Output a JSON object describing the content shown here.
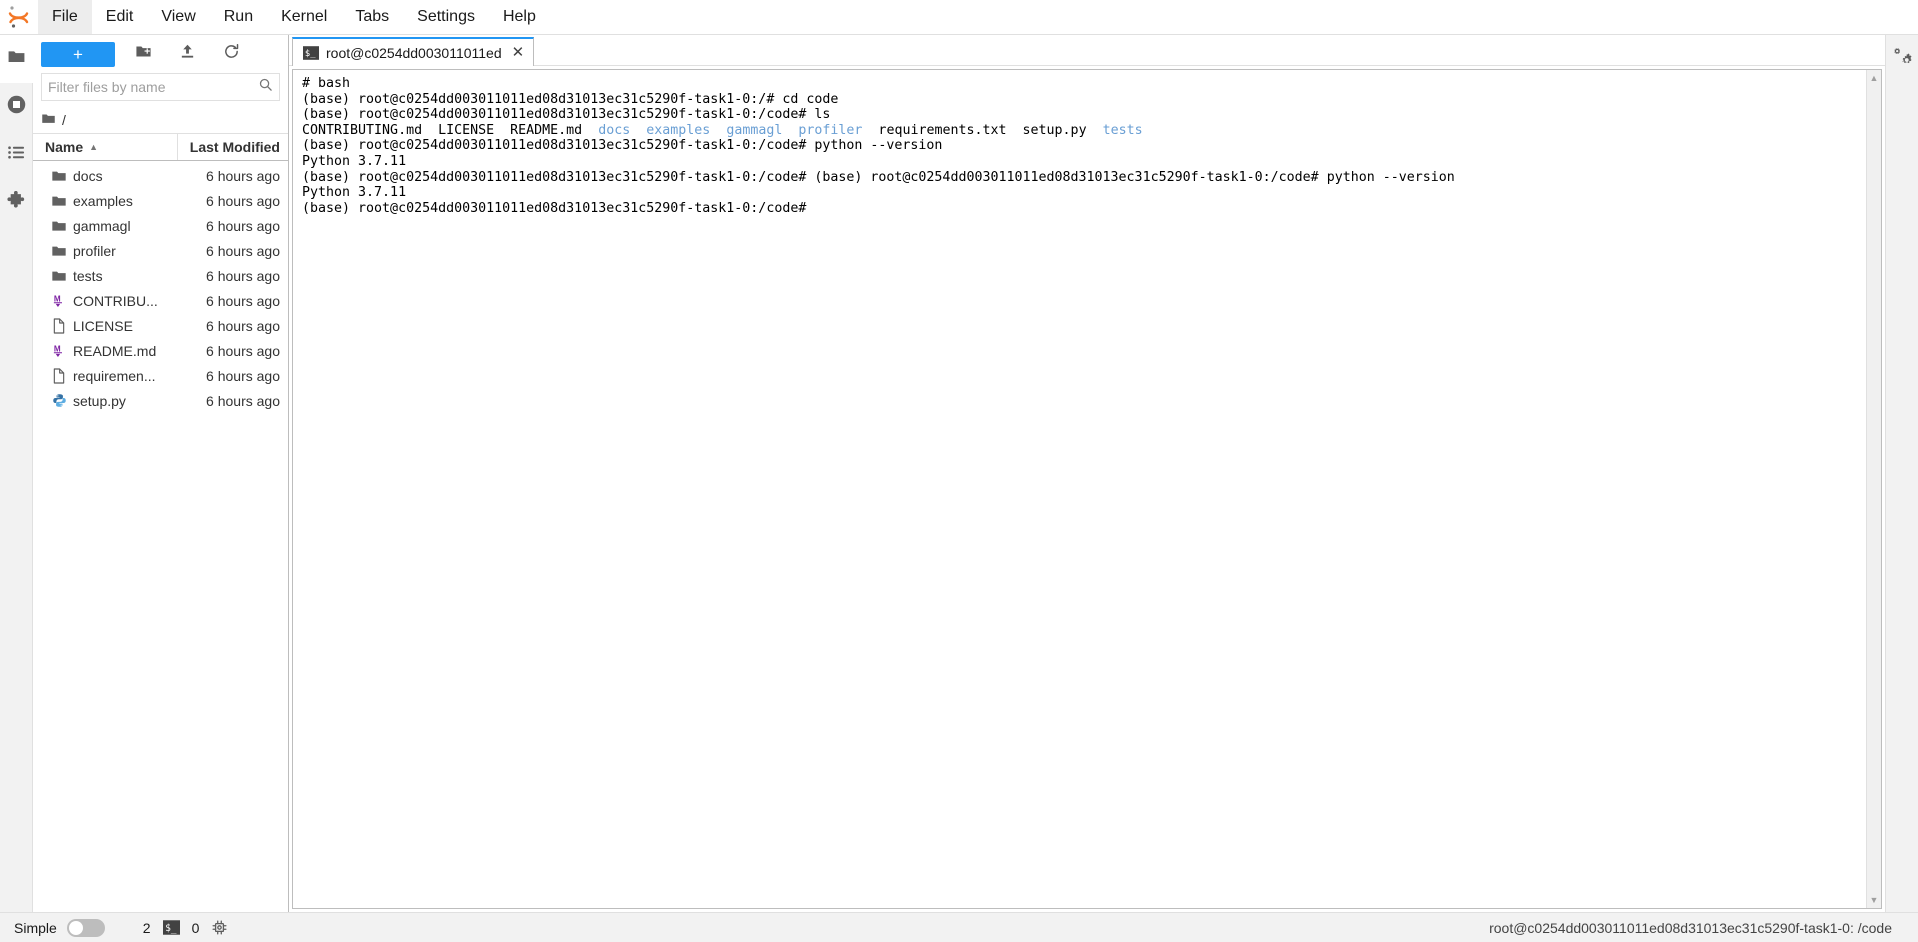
{
  "app": {
    "logo_icon": "jupyter-logo-icon"
  },
  "menubar": {
    "items": [
      {
        "label": "File",
        "name": "menu-file"
      },
      {
        "label": "Edit",
        "name": "menu-edit"
      },
      {
        "label": "View",
        "name": "menu-view"
      },
      {
        "label": "Run",
        "name": "menu-run"
      },
      {
        "label": "Kernel",
        "name": "menu-kernel"
      },
      {
        "label": "Tabs",
        "name": "menu-tabs"
      },
      {
        "label": "Settings",
        "name": "menu-settings"
      },
      {
        "label": "Help",
        "name": "menu-help"
      }
    ]
  },
  "activitybar": {
    "items": [
      {
        "icon": "folder-icon",
        "name": "sidebar-item-file-browser",
        "active": true
      },
      {
        "icon": "running-sessions-icon",
        "name": "sidebar-item-running-terminals",
        "active": false
      },
      {
        "icon": "command-palette-icon",
        "name": "sidebar-item-commands",
        "active": false
      },
      {
        "icon": "extension-puzzle-icon",
        "name": "sidebar-item-extensions",
        "active": false
      }
    ]
  },
  "rightbar": {
    "items": [
      {
        "icon": "property-inspector-gears-icon",
        "name": "sidebar-item-property-inspector"
      }
    ]
  },
  "filebrowser": {
    "toolbar": {
      "new_launcher_label": "+",
      "new_folder_icon": "new-folder-icon",
      "upload_icon": "upload-icon",
      "refresh_icon": "refresh-icon"
    },
    "filter": {
      "placeholder": "Filter files by name",
      "value": "",
      "icon": "search-icon"
    },
    "breadcrumb": {
      "root_icon": "folder-icon",
      "path": "/"
    },
    "columns": {
      "name": "Name",
      "last_modified": "Last Modified",
      "sort_caret": "▲"
    },
    "items": [
      {
        "name": "docs",
        "modified": "6 hours ago",
        "kind": "folder"
      },
      {
        "name": "examples",
        "modified": "6 hours ago",
        "kind": "folder"
      },
      {
        "name": "gammagl",
        "modified": "6 hours ago",
        "kind": "folder"
      },
      {
        "name": "profiler",
        "modified": "6 hours ago",
        "kind": "folder"
      },
      {
        "name": "tests",
        "modified": "6 hours ago",
        "kind": "folder"
      },
      {
        "name": "CONTRIBU...",
        "modified": "6 hours ago",
        "kind": "markdown"
      },
      {
        "name": "LICENSE",
        "modified": "6 hours ago",
        "kind": "file"
      },
      {
        "name": "README.md",
        "modified": "6 hours ago",
        "kind": "markdown"
      },
      {
        "name": "requiremen...",
        "modified": "6 hours ago",
        "kind": "file"
      },
      {
        "name": "setup.py",
        "modified": "6 hours ago",
        "kind": "python"
      }
    ]
  },
  "maindock": {
    "tabs": [
      {
        "label": "root@c0254dd003011011ed",
        "icon": "terminal-icon",
        "close_icon": "✕",
        "active": true
      }
    ]
  },
  "terminal": {
    "scroll_up_icon": "▲",
    "scroll_down_icon": "▼",
    "lines": [
      [
        {
          "t": "# bash"
        }
      ],
      [
        {
          "t": "(base) root@c0254dd003011011ed08d31013ec31c5290f-task1-0:/# cd code"
        }
      ],
      [
        {
          "t": "(base) root@c0254dd003011011ed08d31013ec31c5290f-task1-0:/code# ls"
        }
      ],
      [
        {
          "t": "CONTRIBUTING.md  LICENSE  README.md  "
        },
        {
          "t": "docs",
          "c": "dir"
        },
        {
          "t": "  "
        },
        {
          "t": "examples",
          "c": "dir"
        },
        {
          "t": "  "
        },
        {
          "t": "gammagl",
          "c": "dir"
        },
        {
          "t": "  "
        },
        {
          "t": "profiler",
          "c": "dir"
        },
        {
          "t": "  requirements.txt  setup.py  "
        },
        {
          "t": "tests",
          "c": "dir"
        }
      ],
      [
        {
          "t": "(base) root@c0254dd003011011ed08d31013ec31c5290f-task1-0:/code# python --version"
        }
      ],
      [
        {
          "t": "Python 3.7.11"
        }
      ],
      [
        {
          "t": "(base) root@c0254dd003011011ed08d31013ec31c5290f-task1-0:/code# (base) root@c0254dd003011011ed08d31013ec31c5290f-task1-0:/code# python --version"
        }
      ],
      [
        {
          "t": "Python 3.7.11"
        }
      ],
      [
        {
          "t": "(base) root@c0254dd003011011ed08d31013ec31c5290f-task1-0:/code# "
        }
      ]
    ]
  },
  "statusbar": {
    "simple_label": "Simple",
    "simple_toggle_on": false,
    "kernel_count": "2",
    "terminal_icon": "terminal-icon",
    "terminal_count": "0",
    "kernel_icon": "kernel-cpu-icon",
    "context": "root@c0254dd003011011ed08d31013ec31c5290f-task1-0: /code"
  },
  "colors": {
    "accent_blue": "#2196f3",
    "dir_blue": "#6a9fd4",
    "markdown_purple": "#7b1fa2",
    "python_blue": "#1976d2",
    "chrome_gray": "#f2f2f2"
  }
}
